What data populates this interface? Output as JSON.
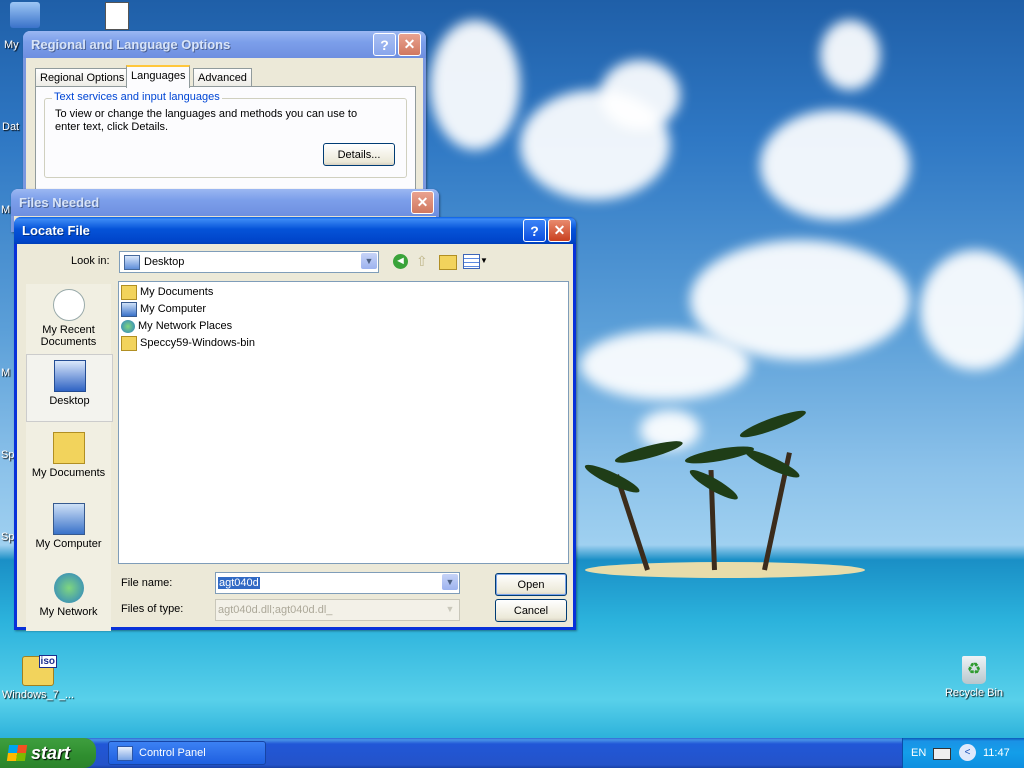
{
  "desktop": {
    "icons": [
      {
        "label": "My"
      },
      {
        "label": "Dat"
      },
      {
        "label": "M"
      },
      {
        "label": "M"
      },
      {
        "label": "Sp"
      },
      {
        "label": "Sp"
      },
      {
        "label": "Windows_7_...",
        "badge": "iso"
      },
      {
        "label": "Recycle Bin"
      }
    ]
  },
  "regional_dialog": {
    "title": "Regional and Language Options",
    "tabs": [
      "Regional Options",
      "Languages",
      "Advanced"
    ],
    "selected_tab": "Languages",
    "group_label": "Text services and input languages",
    "group_text": "To view or change the languages and methods you can use to enter text, click Details.",
    "details_button": "Details..."
  },
  "files_needed": {
    "title": "Files Needed"
  },
  "locate_file": {
    "title": "Locate File",
    "look_in_label": "Look in:",
    "look_in_value": "Desktop",
    "places": [
      {
        "label": "My Recent Documents",
        "icon": "recent-documents-icon"
      },
      {
        "label": "Desktop",
        "icon": "desktop-icon"
      },
      {
        "label": "My Documents",
        "icon": "my-documents-icon"
      },
      {
        "label": "My Computer",
        "icon": "my-computer-icon"
      },
      {
        "label": "My Network",
        "icon": "my-network-icon"
      }
    ],
    "selected_place": "Desktop",
    "files": [
      {
        "name": "My Documents",
        "icon": "folder-documents-icon"
      },
      {
        "name": "My Computer",
        "icon": "computer-icon"
      },
      {
        "name": "My Network Places",
        "icon": "network-places-icon"
      },
      {
        "name": "Speccy59-Windows-bin",
        "icon": "folder-icon"
      }
    ],
    "file_name_label": "File name:",
    "file_name_value": "agt040d",
    "file_type_label": "Files of type:",
    "file_type_value": "agt040d.dll;agt040d.dl_",
    "open_button": "Open",
    "cancel_button": "Cancel"
  },
  "taskbar": {
    "start_label": "start",
    "tasks": [
      {
        "label": "Control Panel"
      }
    ],
    "language": "EN",
    "clock": "11:47"
  },
  "colors": {
    "title_active": "#0553d8",
    "title_inactive": "#7c9fea",
    "dialog_face": "#ece9d8",
    "start_green": "#3c9c3c"
  }
}
